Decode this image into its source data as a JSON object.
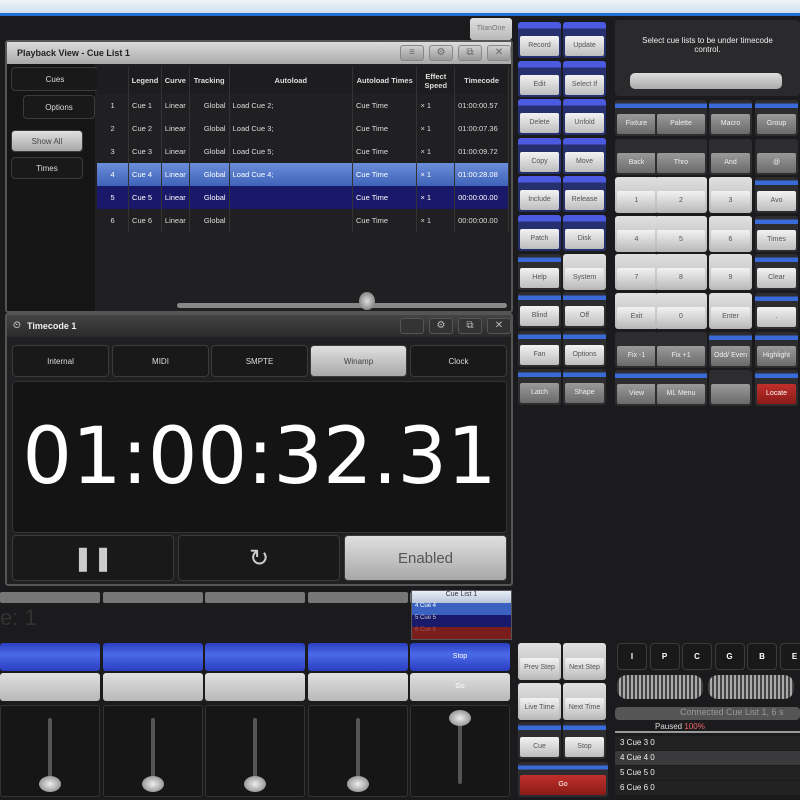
{
  "app": {
    "titan_button": "TitanOne"
  },
  "playback": {
    "title": "Playback View - Cue List 1",
    "side_tabs": [
      "Cues",
      "Options",
      "Show All",
      "Times"
    ],
    "columns": [
      "",
      "Legend",
      "Curve",
      "Tracking",
      "Autoload",
      "Autoload Times",
      "Effect Speed",
      "Timecode"
    ],
    "rows": [
      [
        "1",
        "Cue 1",
        "Linear",
        "Global",
        "Load Cue 2;",
        "Cue Time",
        "× 1",
        "01:00:00.57"
      ],
      [
        "2",
        "Cue 2",
        "Linear",
        "Global",
        "Load Cue 3;",
        "Cue Time",
        "× 1",
        "01:00:07.36"
      ],
      [
        "3",
        "Cue 3",
        "Linear",
        "Global",
        "Load Cue 5;",
        "Cue Time",
        "× 1",
        "01:00:09.72"
      ],
      [
        "4",
        "Cue 4",
        "Linear",
        "Global",
        "Load Cue 4;",
        "Cue Time",
        "× 1",
        "01:00:28.08"
      ],
      [
        "5",
        "Cue 5",
        "Linear",
        "Global",
        "",
        "Cue Time",
        "× 1",
        "00:00:00.00"
      ],
      [
        "6",
        "Cue 6",
        "Linear",
        "Global",
        "",
        "Cue Time",
        "× 1",
        "00:00:00.00"
      ]
    ]
  },
  "timecode": {
    "title": "Timecode 1",
    "sources": [
      "Internal",
      "MIDI",
      "SMPTE",
      "Winamp",
      "Clock"
    ],
    "selected_source": "Winamp",
    "time": "01:00:32.31",
    "enabled_label": "Enabled"
  },
  "message": "Select cue lists to be under timecode control.",
  "left_keys": [
    "Record",
    "Update",
    "Edit",
    "Select If",
    "Delete",
    "Unfold",
    "Copy",
    "Move",
    "Include",
    "Release",
    "Patch",
    "Disk",
    "Help",
    "System",
    "Blind",
    "Off",
    "Fan",
    "Options",
    "Latch",
    "Shape"
  ],
  "keypad": [
    "Fixture",
    "Palette",
    "Macro",
    "Group",
    "Back",
    "Thro",
    "And",
    "@",
    "1",
    "2",
    "3",
    "Avo",
    "4",
    "5",
    "6",
    "Times",
    "7",
    "8",
    "9",
    "Clear",
    "Exit",
    "0",
    "Enter",
    ".",
    "Fix -1",
    "Fix +1",
    "Odd/ Even",
    "Highlight",
    "View",
    "ML Menu",
    "",
    "Locate"
  ],
  "playbacks": {
    "legend_fragment": "e: 1",
    "cue_list_title": "Cue List 1",
    "cue_list_items": [
      "4 Cue 4",
      "5 Cue 5",
      "6 Cue 6"
    ],
    "stop_label": "Stop",
    "go_label": "Go"
  },
  "control": {
    "keys": [
      "Prev Step",
      "Next Step",
      "Live Time",
      "Next Time",
      "Cue",
      "Stop",
      "Go"
    ],
    "wheel_tabs": [
      "I",
      "P",
      "C",
      "G",
      "B",
      "E"
    ],
    "connected": "Connected Cue List 1, 6 s",
    "status": "Paused",
    "status_pct": "100%",
    "cues": [
      "3 Cue 3 0",
      "4 Cue 4 0",
      "5 Cue 5 0",
      "6 Cue 6 0"
    ]
  },
  "colors": {
    "accent_blue": "#3a55d8",
    "red": "#b02a26"
  }
}
